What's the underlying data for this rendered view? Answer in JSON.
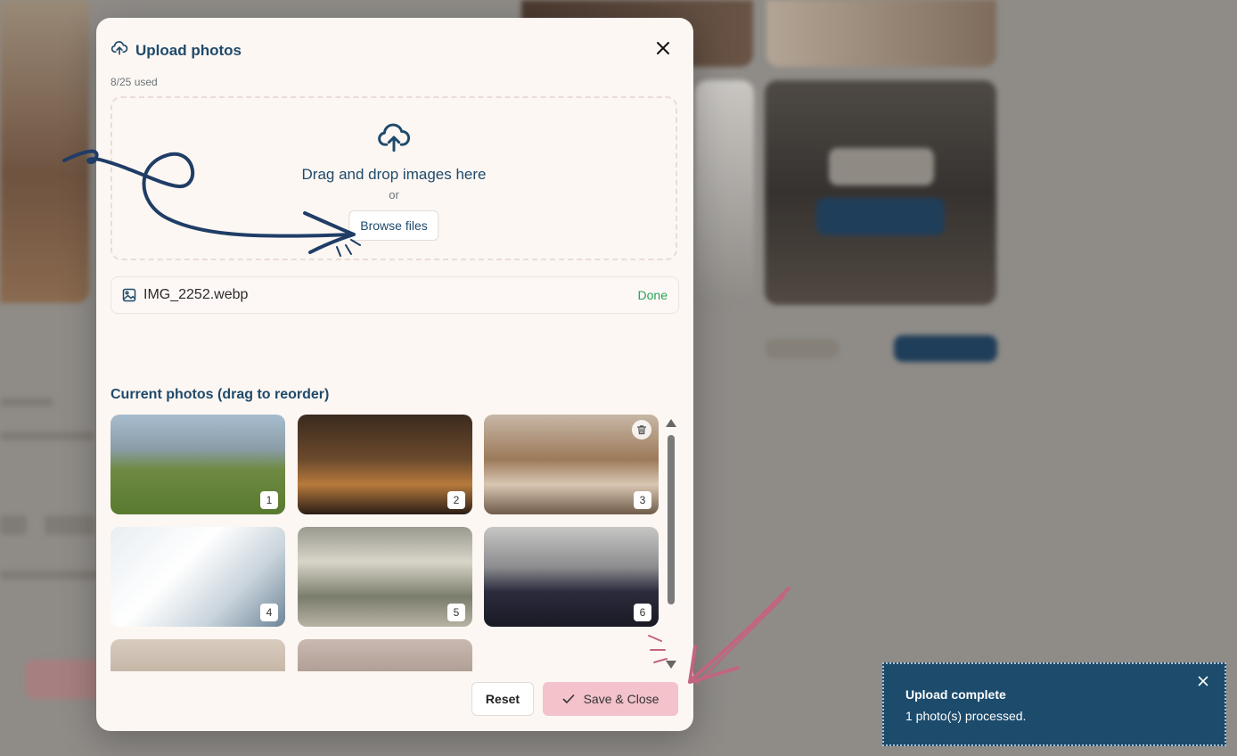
{
  "modal": {
    "title": "Upload photos",
    "usage": "8/25 used",
    "dropzone": {
      "prompt": "Drag and drop images here",
      "or": "or",
      "browse_label": "Browse files"
    },
    "file": {
      "name": "IMG_2252.webp",
      "status": "Done"
    },
    "current_title": "Current photos (drag to reorder)",
    "photos": [
      "1",
      "2",
      "3",
      "4",
      "5",
      "6"
    ],
    "reset_label": "Reset",
    "save_label": "Save & Close"
  },
  "toast": {
    "title": "Upload complete",
    "message": "1 photo(s) processed."
  },
  "colors": {
    "accent": "#1f4a6b",
    "success": "#27a35a",
    "save_button": "#f3c2cb",
    "toast": "#1c4b6c",
    "arrow_blue": "#1f3d66",
    "arrow_pink": "#c2657f"
  }
}
